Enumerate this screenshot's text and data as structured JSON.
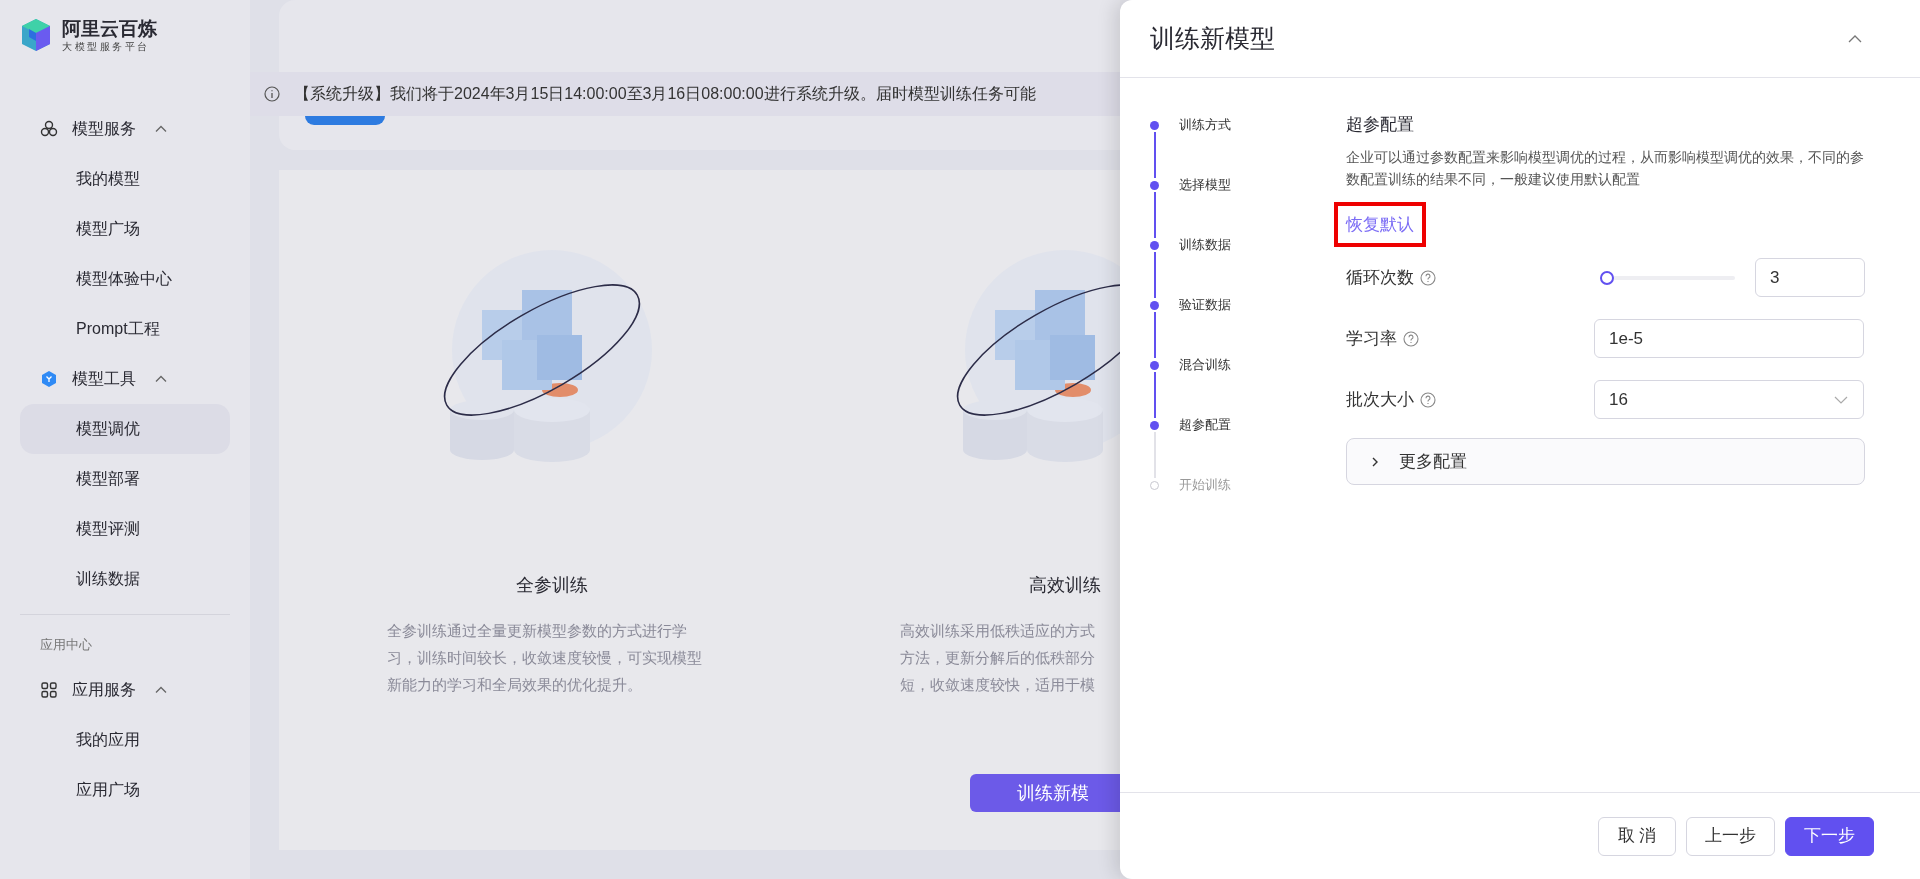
{
  "logo": {
    "title": "阿里云百炼",
    "subtitle": "大模型服务平台"
  },
  "sidebar": {
    "items": [
      {
        "kind": "group",
        "label": "模型服务",
        "expanded": true,
        "children": [
          {
            "label": "我的模型",
            "selected": false
          },
          {
            "label": "模型广场",
            "selected": false
          },
          {
            "label": "模型体验中心",
            "selected": false
          },
          {
            "label": "Prompt工程",
            "selected": false
          }
        ]
      },
      {
        "kind": "group",
        "label": "模型工具",
        "expanded": true,
        "children": [
          {
            "label": "模型调优",
            "selected": true
          },
          {
            "label": "模型部署",
            "selected": false
          },
          {
            "label": "模型评测",
            "selected": false
          },
          {
            "label": "训练数据",
            "selected": false
          }
        ]
      },
      {
        "kind": "heading",
        "label": "应用中心"
      },
      {
        "kind": "group",
        "label": "应用服务",
        "expanded": true,
        "children": [
          {
            "label": "我的应用",
            "selected": false
          },
          {
            "label": "应用广场",
            "selected": false
          }
        ]
      }
    ]
  },
  "notice": {
    "text": "【系统升级】我们将于2024年3月15日14:00:00至3月16日08:00:00进行系统升级。届时模型训练任务可能"
  },
  "training_options": [
    {
      "title": "全参训练",
      "description": [
        "全参训练通过全量更新模型参数的方式进行学",
        "习，训练时间较长，收敛速度较慢，可实现模型",
        "新能力的学习和全局效果的优化提升。"
      ]
    },
    {
      "title": "高效训练",
      "description": [
        "高效训练采用低秩适应的方式",
        "方法，更新分解后的低秩部分",
        "短，收敛速度较快，适用于模"
      ]
    }
  ],
  "main_button": "训练新模",
  "drawer": {
    "title": "训练新模型",
    "steps": [
      {
        "label": "训练方式",
        "done": true
      },
      {
        "label": "选择模型",
        "done": true
      },
      {
        "label": "训练数据",
        "done": true
      },
      {
        "label": "验证数据",
        "done": true
      },
      {
        "label": "混合训练",
        "done": true
      },
      {
        "label": "超参配置",
        "done": true
      },
      {
        "label": "开始训练",
        "done": false
      }
    ],
    "section_title": "超参配置",
    "description": "企业可以通过参数配置来影响模型调优的过程，从而影响模型调优的效果，不同的参数配置训练的结果不同，一般建议使用默认配置",
    "reset_link": {
      "label": "恢复默认",
      "highlighted": true
    },
    "params": [
      {
        "kind": "slider",
        "label": "循环次数",
        "level": 0,
        "value": "3"
      },
      {
        "kind": "input",
        "label": "学习率",
        "value": "1e-5"
      },
      {
        "kind": "select",
        "label": "批次大小",
        "value": "16"
      }
    ],
    "more": {
      "label": "更多配置",
      "expanded": false
    },
    "buttons": [
      {
        "kind": "default",
        "label": "取 消"
      },
      {
        "kind": "default",
        "label": "上一步"
      },
      {
        "kind": "primary",
        "label": "下一步"
      }
    ]
  }
}
